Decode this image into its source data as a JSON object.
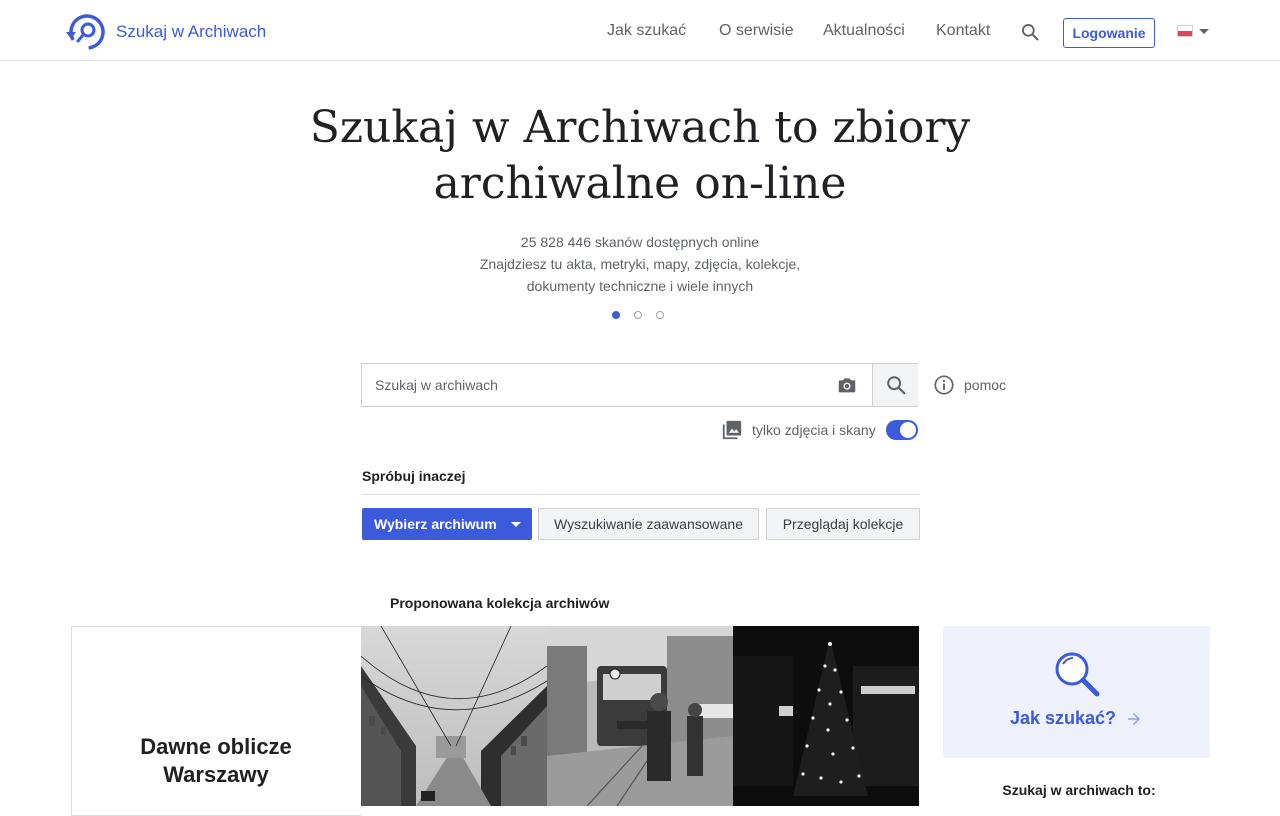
{
  "header": {
    "logo_text": "Szukaj w Archiwach",
    "nav": [
      "Jak szukać",
      "O serwisie",
      "Aktualności",
      "Kontakt"
    ],
    "login_label": "Logowanie",
    "language_flag": "PL"
  },
  "hero": {
    "title_line1": "Szukaj w Archiwach to zbiory",
    "title_line2": "archiwalne on-line",
    "subtitle": [
      "25 828 446 skanów dostępnych online",
      "Znajdziesz tu akta, metryki, mapy, zdjęcia, kolekcje,",
      "dokumenty techniczne i wiele innych"
    ],
    "carousel_active_index": 0,
    "carousel_count": 3
  },
  "search": {
    "placeholder": "Szukaj w archiwach",
    "value": "",
    "help_label": "pomoc",
    "photos_only_label": "tylko zdjęcia i skany",
    "photos_only_enabled": true
  },
  "alternatives": {
    "title": "Spróbuj inaczej",
    "choose_archive_label": "Wybierz archiwum",
    "advanced_search_label": "Wyszukiwanie zaawansowane",
    "browse_collections_label": "Przeglądaj kolekcje"
  },
  "collection": {
    "heading": "Proponowana kolekcja archiwów",
    "title_line1": "Dawne oblicze",
    "title_line2": "Warszawy"
  },
  "howto": {
    "link_label": "Jak szukać?",
    "info_heading": "Szukaj w archiwach to:"
  },
  "colors": {
    "accent": "#3b5bdb",
    "howto_bg": "#eef1fc"
  },
  "icons": [
    "logo-icon",
    "search-icon",
    "chevron-down-icon",
    "camera-icon",
    "info-icon",
    "image-stack-icon",
    "magnifier-icon",
    "arrow-right-icon"
  ]
}
